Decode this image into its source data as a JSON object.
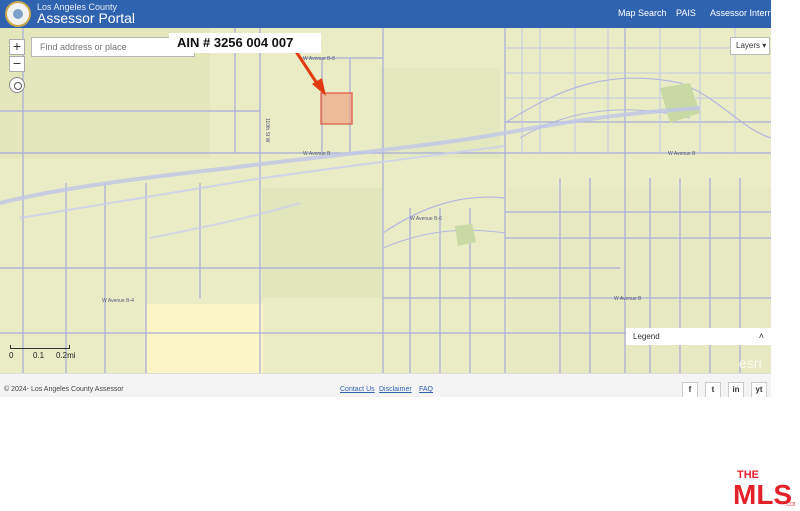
{
  "header": {
    "county": "Los Angeles County",
    "portal": "Assessor Portal",
    "nav": [
      "Map Search",
      "PAIS",
      "Assessor Internet"
    ]
  },
  "map": {
    "search_placeholder": "Find address or place",
    "zoom_in": "+",
    "zoom_out": "−",
    "callout": "AIN # 3256 004 007",
    "layers_label": "Layers",
    "legend_label": "Legend",
    "scale_labels": [
      "0",
      "0.1",
      "0.2mi"
    ],
    "esri": "esri",
    "street_labels": [
      "W Avenue B-8",
      "W Avenue B",
      "W Avenue B-4",
      "W Avenue B-6",
      "W Avenue B",
      "110th St W"
    ]
  },
  "footer": {
    "copyright": "© 2024- Los Angeles County Assessor",
    "links": [
      "Contact Us",
      "Disclaimer",
      "FAQ"
    ],
    "social": [
      "f",
      "t",
      "in",
      "yt"
    ]
  },
  "watermark": "THE MLS .COM",
  "colors": {
    "header": "#2f63b0",
    "parcel_highlight": "#e03a2a",
    "arrow": "#e23b12"
  },
  "icons": [
    "county-seal-icon",
    "locate-icon",
    "chevron-down-icon",
    "chevron-up-icon",
    "facebook-icon",
    "twitter-icon",
    "linkedin-icon",
    "youtube-icon"
  ]
}
